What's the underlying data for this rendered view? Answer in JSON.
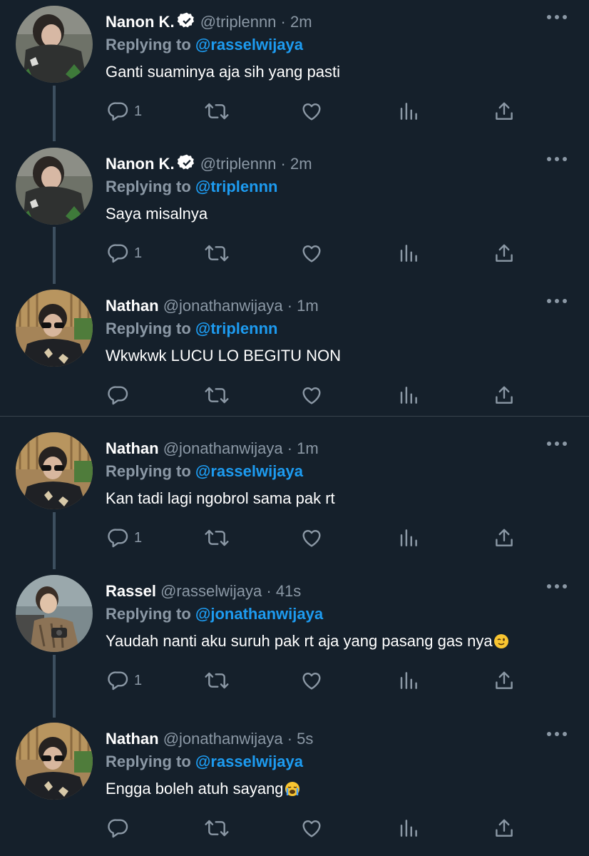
{
  "reply_prefix": "Replying to",
  "colors": {
    "background": "#15202b",
    "link": "#1d9bf0",
    "muted": "#8b98a5"
  },
  "tweets": [
    {
      "name": "Nanon K.",
      "verified": true,
      "handle": "@triplennn",
      "separator": "·",
      "time": "2m",
      "reply_to": "@rasselwijaya",
      "text": "Ganti suaminya aja sih yang pasti",
      "reply_count": "1",
      "avatar": "nanon-avatar"
    },
    {
      "name": "Nanon K.",
      "verified": true,
      "handle": "@triplennn",
      "separator": "·",
      "time": "2m",
      "reply_to": "@triplennn",
      "text": "Saya misalnya",
      "reply_count": "1",
      "avatar": "nanon-avatar"
    },
    {
      "name": "Nathan",
      "verified": false,
      "handle": "@jonathanwijaya",
      "separator": "·",
      "time": "1m",
      "reply_to": "@triplennn",
      "text": "Wkwkwk LUCU LO BEGITU NON",
      "reply_count": "",
      "avatar": "nathan-avatar"
    },
    {
      "name": "Nathan",
      "verified": false,
      "handle": "@jonathanwijaya",
      "separator": "·",
      "time": "1m",
      "reply_to": "@rasselwijaya",
      "text": "Kan tadi lagi ngobrol sama pak rt",
      "reply_count": "1",
      "avatar": "nathan-avatar"
    },
    {
      "name": "Rassel",
      "verified": false,
      "handle": "@rasselwijaya",
      "separator": "·",
      "time": "41s",
      "reply_to": "@jonathanwijaya",
      "text": "Yaudah nanti aku suruh pak rt aja yang pasang gas nya",
      "emoji": "winking-face-emoji",
      "reply_count": "1",
      "avatar": "rassel-avatar"
    },
    {
      "name": "Nathan",
      "verified": false,
      "handle": "@jonathanwijaya",
      "separator": "·",
      "time": "5s",
      "reply_to": "@rasselwijaya",
      "text": "Engga boleh atuh sayang",
      "emoji": "loudly-crying-face-emoji",
      "reply_count": "",
      "avatar": "nathan-avatar"
    }
  ]
}
